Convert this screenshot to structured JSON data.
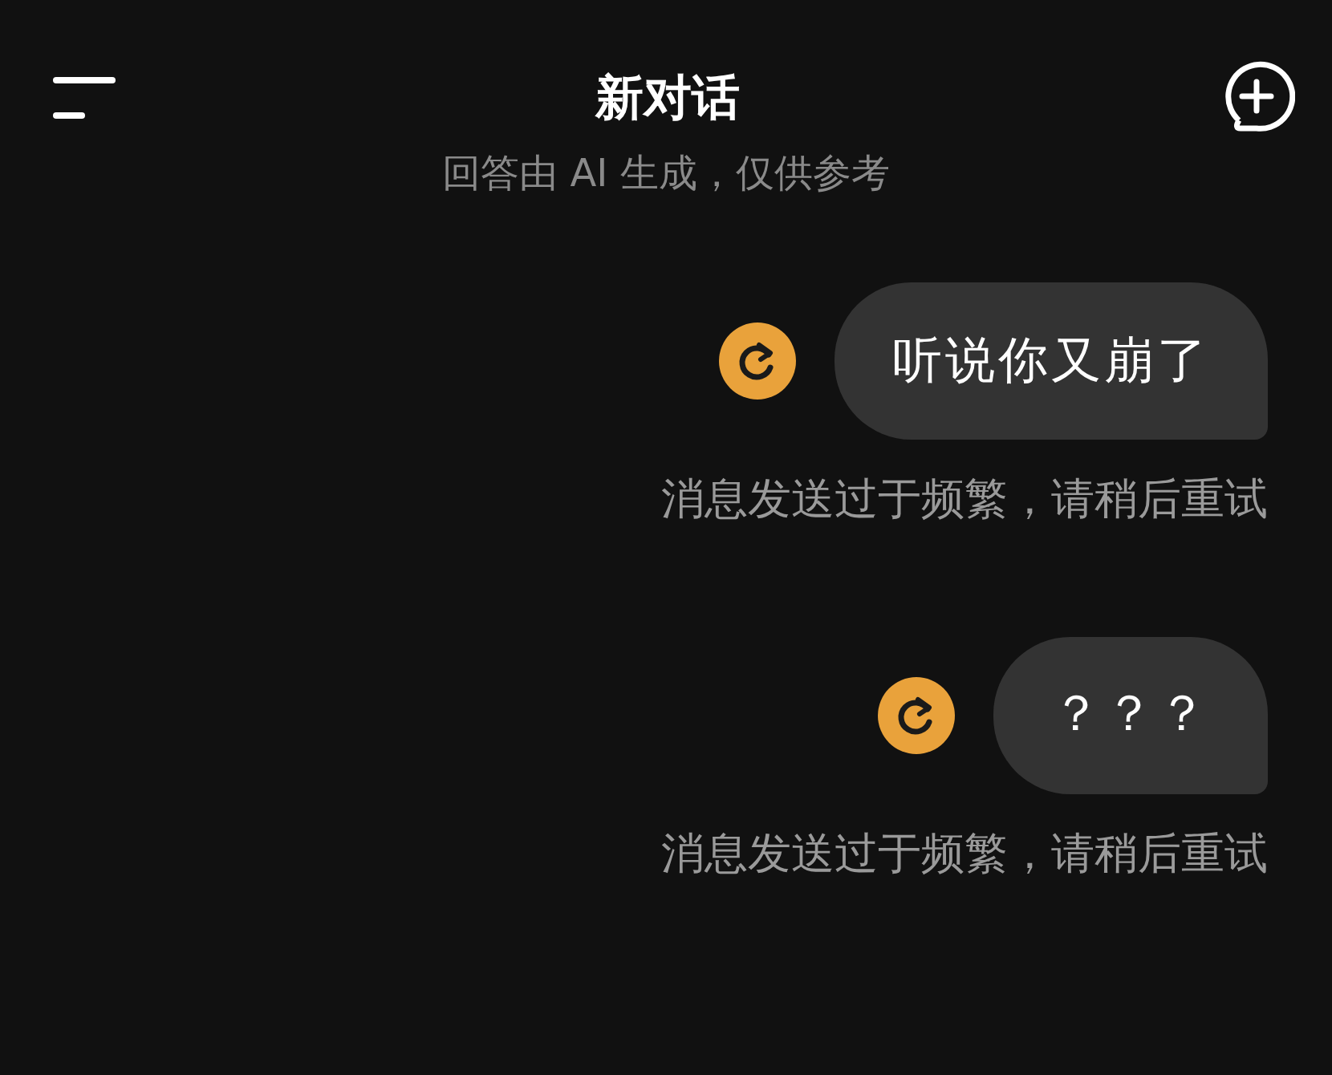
{
  "header": {
    "title": "新对话"
  },
  "notice": "回答由 AI 生成，仅供参考",
  "messages": [
    {
      "text": "听说你又崩了",
      "failed": true,
      "error": "消息发送过于频繁，请稍后重试"
    },
    {
      "text": "？？？",
      "failed": true,
      "error": "消息发送过于频繁，请稍后重试"
    }
  ]
}
